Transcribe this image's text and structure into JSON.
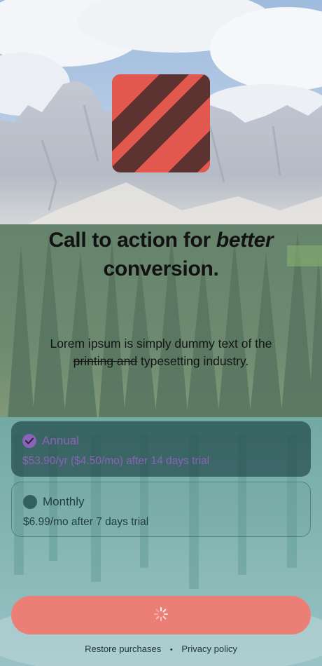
{
  "headline": {
    "part1": "Call to action for ",
    "emphasis": "better",
    "part2": " conversion."
  },
  "subtext": {
    "struck": "printing and",
    "line1": "Lorem ipsum is simply dummy text of the",
    "line2_rest": " typesetting industry."
  },
  "plans": [
    {
      "title": "Annual",
      "detail": "$53.90/yr ($4.50/mo) after 14 days trial",
      "selected": true
    },
    {
      "title": "Monthly",
      "detail": "$6.99/mo after 7 days trial",
      "selected": false
    }
  ],
  "cta": {
    "state": "loading",
    "icon": "spinner-icon"
  },
  "footer": {
    "restore": "Restore purchases",
    "separator": "•",
    "privacy": "Privacy policy"
  },
  "colors": {
    "accent": "#ec7f75",
    "logo_red": "#e2584e",
    "logo_dark": "#5c3330",
    "selected_plan": "#8a62b8"
  }
}
